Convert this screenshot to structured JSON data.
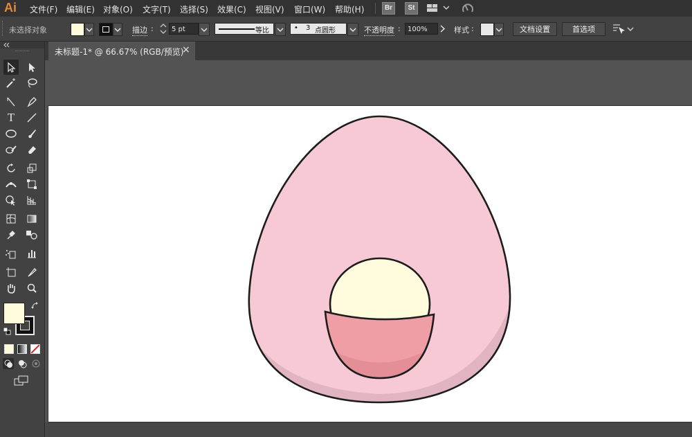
{
  "app": {
    "logo": "Ai"
  },
  "menubar": {
    "items": [
      "文件(F)",
      "编辑(E)",
      "对象(O)",
      "文字(T)",
      "选择(S)",
      "效果(C)",
      "视图(V)",
      "窗口(W)",
      "帮助(H)"
    ],
    "bridge_label": "Br",
    "stock_label": "St"
  },
  "controlbar": {
    "selection_status": "未选择对象",
    "fill_color": "#fffbdc",
    "stroke_label": "描边",
    "stroke_weight": "5 pt",
    "stroke_profile": "等比",
    "brush_dot": "•",
    "brush_size": "3",
    "brush_name": "点圆形",
    "opacity_label": "不透明度",
    "opacity_value": "100%",
    "style_label": "样式",
    "doc_setup_button": "文档设置",
    "prefs_button": "首选项"
  },
  "document": {
    "tab_title": "未标题-1* @ 66.67% (RGB/预览)",
    "close_glyph": "×"
  },
  "colors": {
    "egg_body": "#f6c9d5",
    "egg_shadow": "#e0b4c1",
    "yolk": "#fffbdc",
    "cup": "#f09ea6",
    "cup_shadow": "#e48e98",
    "outline": "#1c1c1c"
  },
  "icons": {
    "swap": "swap-fill-stroke-icon",
    "default": "default-colors-icon"
  }
}
